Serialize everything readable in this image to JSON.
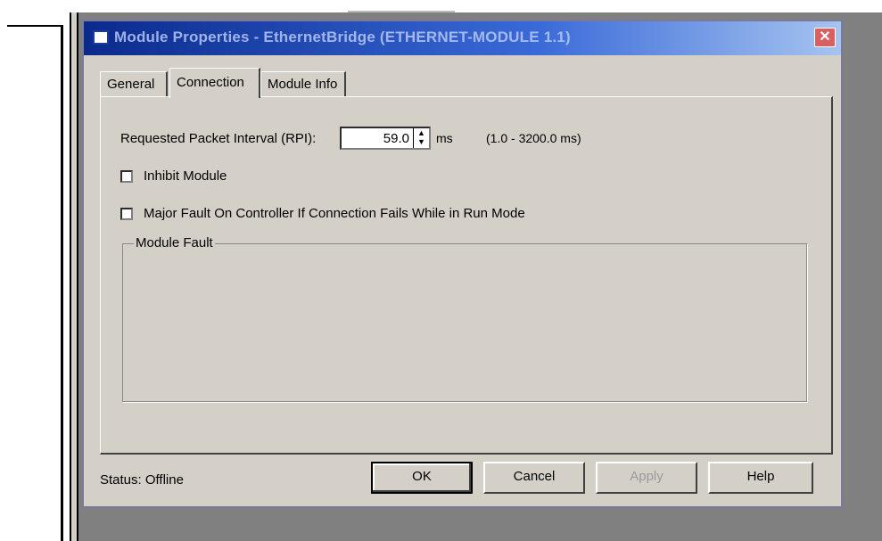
{
  "dialog": {
    "title": "Module Properties - EthernetBridge (ETHERNET-MODULE 1.1)",
    "close_glyph": "✕"
  },
  "tabs": [
    {
      "label": "General",
      "active": false
    },
    {
      "label": "Connection",
      "active": true
    },
    {
      "label": "Module Info",
      "active": false
    }
  ],
  "connection": {
    "rpi_label": "Requested Packet Interval (RPI):",
    "rpi_value": "59.0",
    "rpi_units": "ms",
    "rpi_range": "(1.0 - 3200.0 ms)",
    "inhibit_label": "Inhibit Module",
    "inhibit_checked": false,
    "major_fault_label": "Major Fault On Controller If Connection Fails While in Run Mode",
    "major_fault_checked": false,
    "module_fault_label": "Module Fault"
  },
  "footer": {
    "status": "Status:  Offline",
    "ok": "OK",
    "cancel": "Cancel",
    "apply": "Apply",
    "help": "Help"
  },
  "colors": {
    "title_bar_start": "#0a2a8c",
    "title_bar_end": "#a6c4f0",
    "dialog_bg": "#d4d0c8",
    "desktop_bg": "#808080"
  }
}
